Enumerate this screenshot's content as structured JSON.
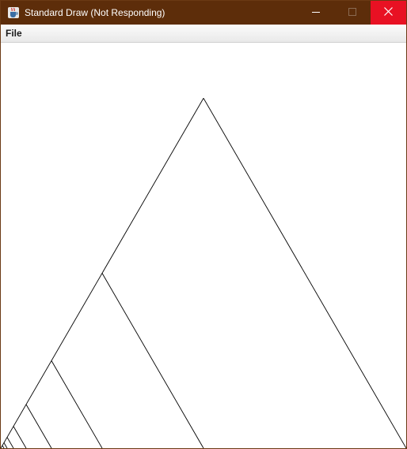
{
  "window": {
    "title": "Standard Draw (Not Responding)",
    "title_bar_color": "#5d2d0a",
    "close_button_color": "#e81123",
    "icon": "java-cup-icon"
  },
  "caption_buttons": {
    "minimize": "minimize-icon",
    "maximize": "maximize-icon",
    "close": "close-icon"
  },
  "menubar": {
    "items": [
      {
        "label": "File"
      }
    ]
  },
  "canvas": {
    "background": "#ffffff",
    "stroke_color": "#000000",
    "drawing": "sierpinski-like nested triangles"
  }
}
